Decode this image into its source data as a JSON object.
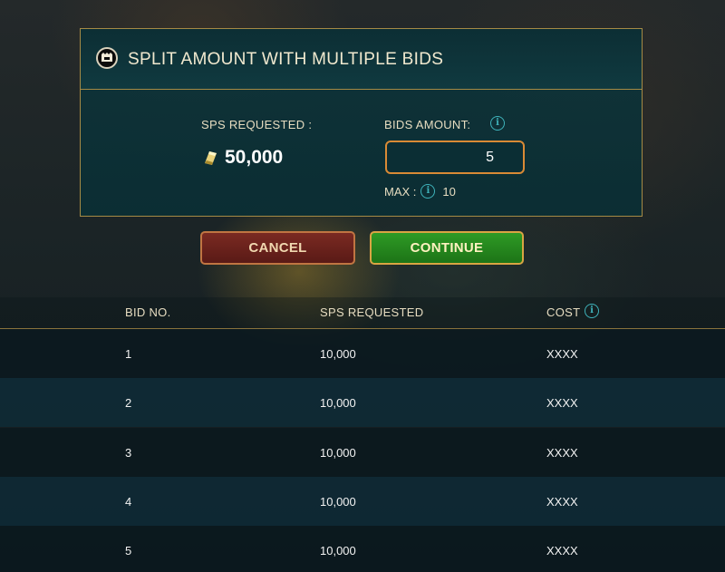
{
  "modal": {
    "title": "SPLIT AMOUNT WITH MULTIPLE BIDS",
    "sps_requested_label": "SPS REQUESTED :",
    "sps_requested_value": "50,000",
    "bids_amount_label": "BIDS AMOUNT:",
    "bids_amount_value": "5",
    "max_label": "MAX :",
    "max_value": "10"
  },
  "buttons": {
    "cancel": "CANCEL",
    "continue": "CONTINUE"
  },
  "table": {
    "headers": [
      "BID NO.",
      "SPS REQUESTED",
      "COST"
    ],
    "rows": [
      [
        "1",
        "10,000",
        "XXXX"
      ],
      [
        "2",
        "10,000",
        "XXXX"
      ],
      [
        "3",
        "10,000",
        "XXXX"
      ],
      [
        "4",
        "10,000",
        "XXXX"
      ],
      [
        "5",
        "10,000",
        "XXXX"
      ]
    ]
  },
  "icons": {
    "header": "splinterlands-logo-icon",
    "coin": "sps-coin-icon",
    "info": "info-icon"
  },
  "colors": {
    "border_gold": "#a58a45",
    "accent_teal": "#3fb3bb",
    "input_border": "#d98a35",
    "cancel_bg": "#7a2a22",
    "continue_bg": "#2e9a25"
  }
}
